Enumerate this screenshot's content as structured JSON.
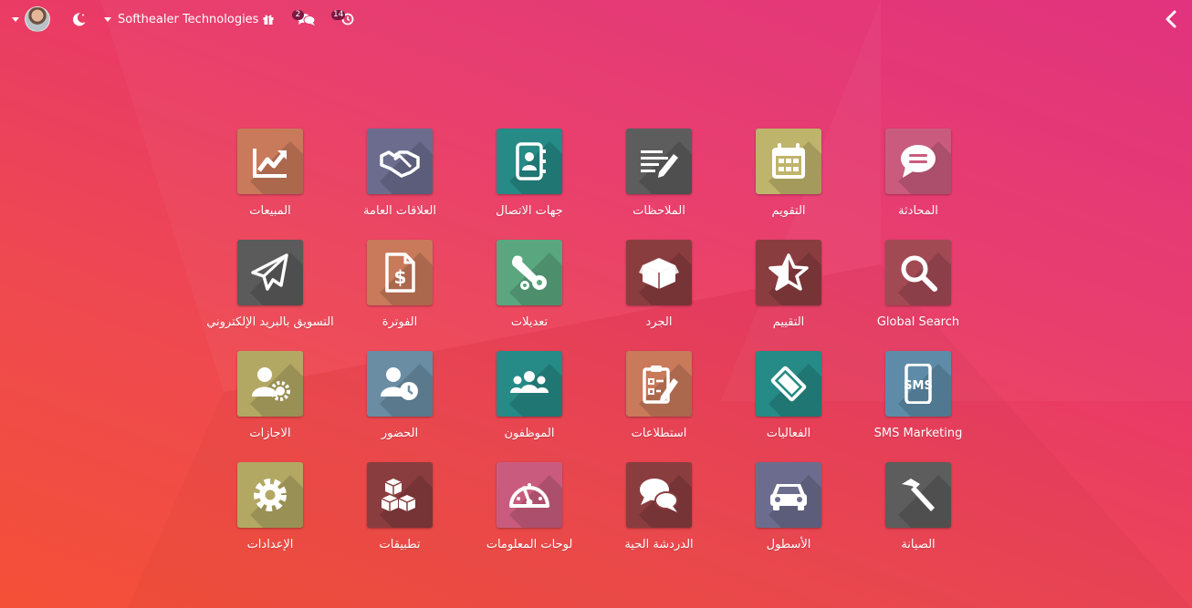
{
  "topbar": {
    "company": "Softhealer Technologies",
    "messages_count": "2",
    "activities_count": "14"
  },
  "colors": {
    "bg_top_right": "#e02d7a",
    "bg_bottom_left": "#f45037"
  },
  "apps": [
    {
      "label": "المبيعات",
      "icon": "trend-chart-icon",
      "color": "#c87a5a"
    },
    {
      "label": "العلاقات العامة",
      "icon": "handshake-icon",
      "color": "#6c6d8e"
    },
    {
      "label": "جهات الاتصال",
      "icon": "address-book-icon",
      "color": "#268a86"
    },
    {
      "label": "الملاحظات",
      "icon": "note-pencil-icon",
      "color": "#5d5d5d"
    },
    {
      "label": "التقويم",
      "icon": "calendar-icon",
      "color": "#bfb46b"
    },
    {
      "label": "المحادثة",
      "icon": "chat-bubble-icon",
      "color": "#c95c7e"
    },
    {
      "label": "التسويق بالبريد الإلكتروني",
      "icon": "paper-plane-icon",
      "color": "#5b5b5b"
    },
    {
      "label": "الفوترة",
      "icon": "invoice-dollar-icon",
      "color": "#c87a5a"
    },
    {
      "label": "تعديلات",
      "icon": "wrench-gears-icon",
      "color": "#5aa77f"
    },
    {
      "label": "الجرد",
      "icon": "open-box-icon",
      "color": "#8a3d3f"
    },
    {
      "label": "التقييم",
      "icon": "star-half-icon",
      "color": "#8a3d3f"
    },
    {
      "label": "Global Search",
      "icon": "magnifier-icon",
      "color": "#a24a54"
    },
    {
      "label": "الاجازات",
      "icon": "user-gear-icon",
      "color": "#b3a863"
    },
    {
      "label": "الحضور",
      "icon": "user-clock-icon",
      "color": "#6a8da3"
    },
    {
      "label": "الموظفون",
      "icon": "users-group-icon",
      "color": "#268a86"
    },
    {
      "label": "استطلاعات",
      "icon": "survey-clipboard-icon",
      "color": "#c87a5a"
    },
    {
      "label": "الفعاليات",
      "icon": "ticket-icon",
      "color": "#268a86"
    },
    {
      "label": "SMS Marketing",
      "icon": "sms-phone-icon",
      "color": "#5e8ca8"
    },
    {
      "label": "الإعدادات",
      "icon": "gear-icon",
      "color": "#b3a863"
    },
    {
      "label": "تطبيقات",
      "icon": "cubes-icon",
      "color": "#8a3d3f"
    },
    {
      "label": "لوحات المعلومات",
      "icon": "dashboard-gauge-icon",
      "color": "#c95c7e"
    },
    {
      "label": "الدردشة الحية",
      "icon": "chat-bubbles-icon",
      "color": "#8a3d3f"
    },
    {
      "label": "الأسطول",
      "icon": "car-icon",
      "color": "#6c6d8e"
    },
    {
      "label": "الصيانة",
      "icon": "hammer-icon",
      "color": "#5d5d5d"
    }
  ]
}
